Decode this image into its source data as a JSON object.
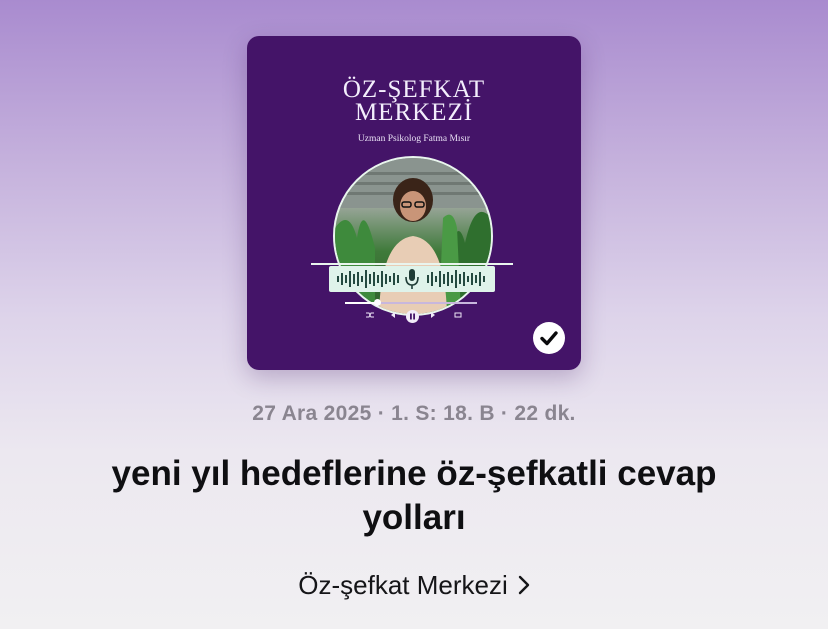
{
  "artwork": {
    "title_line1": "ÖZ-ŞEFKAT",
    "title_line2": "MERKEZİ",
    "subtitle": "Uzman Psikolog Fatma Mısır",
    "background": "#441468",
    "icons": [
      "shuffle-icon",
      "previous-icon",
      "pause-icon",
      "next-icon",
      "repeat-icon",
      "microphone-icon"
    ],
    "progress": 0.24,
    "status_icon": "checkmark-icon"
  },
  "episode": {
    "meta": "27 Ara 2025 · 1. S: 18. B · 22 dk.",
    "title": "yeni yıl hedeflerine öz-şefkatli cevap yolları",
    "show_name": "Öz-şefkat Merkezi",
    "show_chevron_icon": "chevron-right-icon"
  }
}
